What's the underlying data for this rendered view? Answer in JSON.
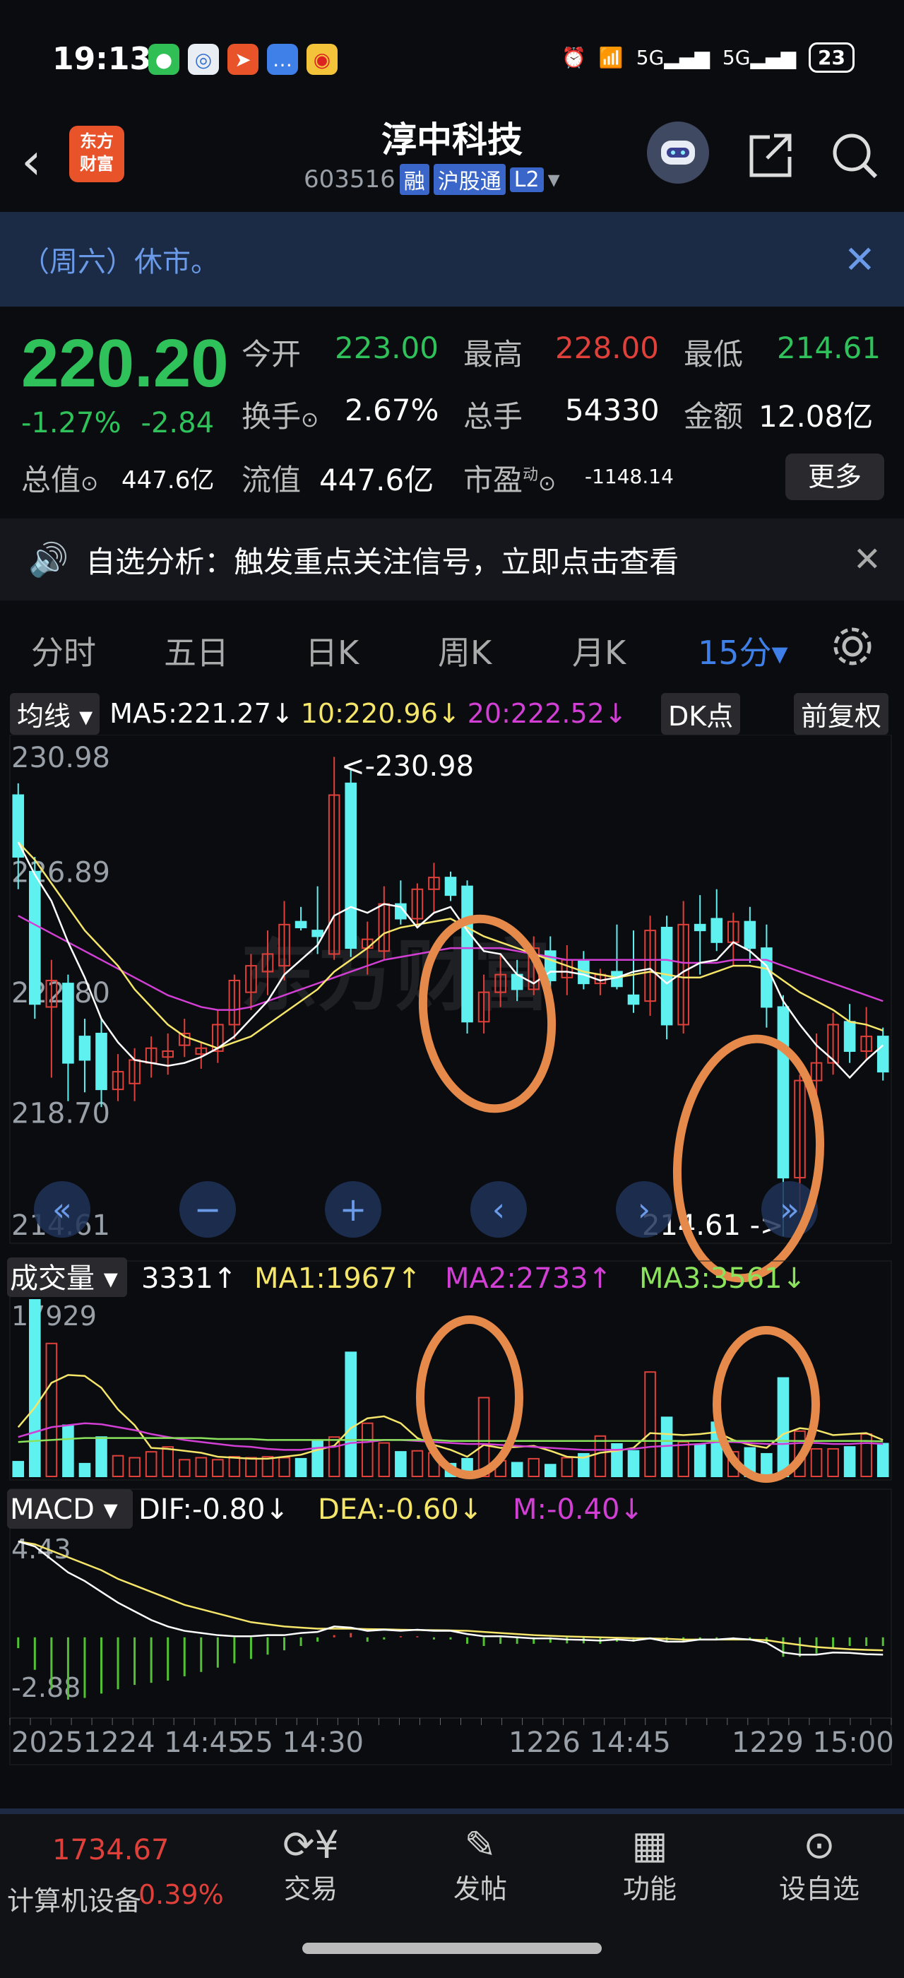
{
  "status": {
    "time": "19:13",
    "network": "5G",
    "battery": "23"
  },
  "header": {
    "title": "淳中科技",
    "code": "603516",
    "tags": [
      "融",
      "沪股通",
      "L2"
    ],
    "logo_line1": "东方",
    "logo_line2": "财富"
  },
  "notice": {
    "text": "（周六）休市。"
  },
  "quote": {
    "price": "220.20",
    "change_pct": "-1.27%",
    "change": "-2.84",
    "open_label": "今开",
    "open": "223.00",
    "high_label": "最高",
    "high": "228.00",
    "low_label": "最低",
    "low": "214.61",
    "turnover_label": "换手",
    "turnover": "2.67%",
    "volume_label": "总手",
    "volume": "54330",
    "amount_label": "金额",
    "amount": "12.08亿",
    "mktcap_label": "总值",
    "mktcap": "447.6亿",
    "float_label": "流值",
    "float": "447.6亿",
    "pe_label": "市盈",
    "pe_sup": "动",
    "pe": "-1148.14",
    "more": "更多"
  },
  "announcement": {
    "text": "自选分析：触发重点关注信号，立即点击查看"
  },
  "tabs": [
    "分时",
    "五日",
    "日K",
    "周K",
    "月K",
    "15分▾"
  ],
  "ma": {
    "selector": "均线",
    "ma5": "MA5:221.27↓",
    "ma10": "10:220.96↓",
    "ma20": "20:222.52↓",
    "dk": "DK点",
    "fq": "前复权"
  },
  "kline": {
    "y_labels": [
      "230.98",
      "226.89",
      "222.80",
      "218.70",
      "214.61"
    ],
    "max_label": "<-230.98",
    "min_label": "214.61 ->",
    "watermark": "东方财富"
  },
  "volume": {
    "selector": "成交量",
    "cur": "3331↑",
    "ma1": "MA1:1967↑",
    "ma2": "MA2:2733↑",
    "ma3": "MA3:3561↓",
    "ymax": "17929"
  },
  "macd": {
    "selector": "MACD",
    "dif": "DIF:-0.80↓",
    "dea": "DEA:-0.60↓",
    "m": "M:-0.40↓",
    "ymax": "4.43",
    "ymin": "-2.88"
  },
  "xaxis": {
    "l1": "20251224 14:45",
    "l2": "25 14:30",
    "l3": "1226 14:45",
    "l4": "1229 15:00"
  },
  "bottom": {
    "index_value": "1734.67",
    "index_name": "计算机设备",
    "index_pct": "0.39%",
    "nav": [
      "交易",
      "发帖",
      "功能",
      "设自选"
    ]
  },
  "colors": {
    "up": "#e0403a",
    "down": "#5ff0f0",
    "ma5": "#ffffff",
    "ma10": "#f5e66a",
    "ma20": "#d23fd4",
    "ma3": "#8be25d",
    "accent": "#3f7fe8"
  },
  "chart_data": {
    "type": "candlestick",
    "ylim": [
      214.61,
      230.98
    ],
    "candles": [
      {
        "o": 229.6,
        "h": 230.0,
        "l": 226.4,
        "c": 227.5
      },
      {
        "o": 227.0,
        "h": 227.5,
        "l": 222.0,
        "c": 222.5
      },
      {
        "o": 222.4,
        "h": 224.0,
        "l": 220.0,
        "c": 223.3
      },
      {
        "o": 223.2,
        "h": 223.5,
        "l": 219.2,
        "c": 220.5
      },
      {
        "o": 221.4,
        "h": 222.0,
        "l": 219.5,
        "c": 220.6
      },
      {
        "o": 221.5,
        "h": 222.0,
        "l": 219.0,
        "c": 219.6
      },
      {
        "o": 219.6,
        "h": 220.8,
        "l": 219.2,
        "c": 220.2
      },
      {
        "o": 219.8,
        "h": 221.0,
        "l": 219.2,
        "c": 220.6
      },
      {
        "o": 220.5,
        "h": 221.4,
        "l": 220.0,
        "c": 221.0
      },
      {
        "o": 220.7,
        "h": 221.5,
        "l": 220.1,
        "c": 220.9
      },
      {
        "o": 221.1,
        "h": 222.0,
        "l": 220.7,
        "c": 221.5
      },
      {
        "o": 220.8,
        "h": 221.2,
        "l": 220.3,
        "c": 221.0
      },
      {
        "o": 220.9,
        "h": 222.3,
        "l": 220.5,
        "c": 221.8
      },
      {
        "o": 221.8,
        "h": 223.5,
        "l": 221.3,
        "c": 223.3
      },
      {
        "o": 222.9,
        "h": 224.2,
        "l": 222.3,
        "c": 223.8
      },
      {
        "o": 223.6,
        "h": 225.0,
        "l": 222.8,
        "c": 224.2
      },
      {
        "o": 223.8,
        "h": 226.0,
        "l": 223.3,
        "c": 225.2
      },
      {
        "o": 225.3,
        "h": 225.8,
        "l": 225.0,
        "c": 225.1
      },
      {
        "o": 225.0,
        "h": 226.5,
        "l": 224.2,
        "c": 224.8
      },
      {
        "o": 224.2,
        "h": 230.9,
        "l": 224.0,
        "c": 229.6
      },
      {
        "o": 230.0,
        "h": 230.5,
        "l": 224.1,
        "c": 224.4
      },
      {
        "o": 224.4,
        "h": 225.3,
        "l": 223.5,
        "c": 224.7
      },
      {
        "o": 224.3,
        "h": 226.5,
        "l": 224.0,
        "c": 225.9
      },
      {
        "o": 225.9,
        "h": 226.7,
        "l": 225.2,
        "c": 225.4
      },
      {
        "o": 225.4,
        "h": 226.6,
        "l": 225.1,
        "c": 226.4
      },
      {
        "o": 226.4,
        "h": 227.3,
        "l": 225.6,
        "c": 226.8
      },
      {
        "o": 226.8,
        "h": 227.0,
        "l": 226.0,
        "c": 226.2
      },
      {
        "o": 226.5,
        "h": 226.7,
        "l": 221.5,
        "c": 221.9
      },
      {
        "o": 221.9,
        "h": 223.5,
        "l": 221.5,
        "c": 222.9
      },
      {
        "o": 222.9,
        "h": 224.2,
        "l": 222.4,
        "c": 223.5
      },
      {
        "o": 223.5,
        "h": 224.0,
        "l": 222.6,
        "c": 223.0
      },
      {
        "o": 223.0,
        "h": 224.8,
        "l": 222.8,
        "c": 224.4
      },
      {
        "o": 224.3,
        "h": 224.8,
        "l": 223.0,
        "c": 223.3
      },
      {
        "o": 223.4,
        "h": 224.5,
        "l": 222.8,
        "c": 224.0
      },
      {
        "o": 224.0,
        "h": 224.3,
        "l": 223.0,
        "c": 223.2
      },
      {
        "o": 223.2,
        "h": 223.7,
        "l": 222.8,
        "c": 223.5
      },
      {
        "o": 223.6,
        "h": 225.2,
        "l": 223.0,
        "c": 223.1
      },
      {
        "o": 222.8,
        "h": 225.0,
        "l": 222.2,
        "c": 222.5
      },
      {
        "o": 222.6,
        "h": 225.5,
        "l": 222.1,
        "c": 225.0
      },
      {
        "o": 225.1,
        "h": 225.5,
        "l": 221.3,
        "c": 221.8
      },
      {
        "o": 221.8,
        "h": 226.0,
        "l": 221.5,
        "c": 225.2
      },
      {
        "o": 225.2,
        "h": 226.2,
        "l": 223.5,
        "c": 225.0
      },
      {
        "o": 225.4,
        "h": 226.4,
        "l": 224.3,
        "c": 224.6
      },
      {
        "o": 224.6,
        "h": 225.6,
        "l": 223.8,
        "c": 225.3
      },
      {
        "o": 225.3,
        "h": 225.8,
        "l": 223.9,
        "c": 224.4
      },
      {
        "o": 224.4,
        "h": 225.2,
        "l": 221.7,
        "c": 222.4
      },
      {
        "o": 222.4,
        "h": 222.8,
        "l": 214.61,
        "c": 216.6
      },
      {
        "o": 216.6,
        "h": 220.1,
        "l": 215.4,
        "c": 219.9
      },
      {
        "o": 219.9,
        "h": 221.5,
        "l": 219.2,
        "c": 220.5
      },
      {
        "o": 220.5,
        "h": 222.2,
        "l": 220.1,
        "c": 221.8
      },
      {
        "o": 221.9,
        "h": 222.5,
        "l": 220.5,
        "c": 220.9
      },
      {
        "o": 220.9,
        "h": 222.4,
        "l": 220.6,
        "c": 221.4
      },
      {
        "o": 221.4,
        "h": 221.7,
        "l": 219.9,
        "c": 220.2
      }
    ],
    "ma5": [
      228.0,
      226.9,
      226.0,
      224.6,
      223.4,
      222.0,
      221.2,
      220.6,
      220.5,
      220.4,
      220.5,
      220.7,
      221.0,
      221.4,
      222.0,
      222.6,
      223.5,
      224.0,
      224.5,
      225.5,
      225.8,
      225.6,
      225.9,
      225.8,
      225.1,
      225.6,
      225.8,
      225.0,
      224.3,
      224.2,
      223.5,
      223.2,
      223.6,
      223.6,
      223.5,
      223.3,
      223.4,
      223.6,
      223.7,
      223.2,
      223.6,
      223.9,
      224.0,
      224.6,
      224.3,
      223.8,
      222.6,
      221.8,
      221.1,
      220.6,
      220.0,
      220.6,
      221.1
    ],
    "ma10": [
      228.0,
      227.4,
      226.6,
      225.8,
      225.0,
      224.4,
      223.8,
      223.0,
      222.4,
      221.8,
      221.4,
      221.2,
      221.0,
      221.2,
      221.4,
      221.8,
      222.2,
      222.6,
      223.0,
      223.6,
      224.0,
      224.4,
      224.9,
      225.1,
      225.2,
      225.3,
      225.4,
      225.1,
      224.8,
      224.6,
      224.4,
      224.2,
      224.0,
      223.8,
      223.6,
      223.5,
      223.4,
      223.5,
      223.6,
      223.5,
      223.4,
      223.4,
      223.6,
      223.8,
      223.8,
      223.7,
      223.3,
      222.9,
      222.6,
      222.3,
      221.9,
      221.8,
      221.6
    ],
    "ma20": [
      225.5,
      225.2,
      224.9,
      224.6,
      224.3,
      224.0,
      223.7,
      223.4,
      223.1,
      222.8,
      222.6,
      222.4,
      222.3,
      222.3,
      222.4,
      222.6,
      222.8,
      223.0,
      223.2,
      223.4,
      223.6,
      223.8,
      224.0,
      224.1,
      224.2,
      224.3,
      224.4,
      224.4,
      224.4,
      224.4,
      224.3,
      224.2,
      224.1,
      224.0,
      224.0,
      224.0,
      224.0,
      224.0,
      224.0,
      224.0,
      223.9,
      223.9,
      223.9,
      224.0,
      224.0,
      224.0,
      223.8,
      223.6,
      223.4,
      223.2,
      223.0,
      222.8,
      222.6
    ],
    "volume": [
      1500,
      17929,
      13500,
      5200,
      1300,
      4000,
      2100,
      1900,
      2500,
      3000,
      1700,
      1900,
      1700,
      2000,
      1900,
      2000,
      1900,
      1800,
      3600,
      4000,
      12600,
      5400,
      3400,
      2500,
      2600,
      2400,
      1300,
      1800,
      8000,
      1600,
      1400,
      1800,
      1200,
      1900,
      2300,
      4100,
      3300,
      2600,
      10600,
      6000,
      3500,
      3200,
      5500,
      2500,
      2900,
      2300,
      10000,
      4600,
      2800,
      2800,
      3000,
      4300,
      3331
    ],
    "vol_ma1": [
      5000,
      7000,
      9500,
      10300,
      10200,
      9000,
      6800,
      5200,
      2900,
      2800,
      2600,
      2400,
      2000,
      1900,
      1800,
      1800,
      2000,
      2200,
      2700,
      3100,
      4900,
      5900,
      6100,
      5400,
      3900,
      3200,
      2700,
      2000,
      3200,
      2900,
      3000,
      3100,
      2600,
      2000,
      1900,
      2400,
      2600,
      2900,
      4400,
      4300,
      4200,
      4300,
      4500,
      3700,
      3200,
      2900,
      4300,
      4900,
      4700,
      4200,
      4300,
      4400,
      3700
    ],
    "vol_ma2": [
      4000,
      4500,
      5000,
      5200,
      5400,
      5300,
      5000,
      4700,
      4300,
      4000,
      3700,
      3500,
      3300,
      3100,
      3000,
      2800,
      2700,
      2700,
      2900,
      3000,
      3400,
      3500,
      3700,
      3700,
      3600,
      3500,
      3400,
      3300,
      3300,
      3200,
      3100,
      3000,
      2900,
      2800,
      2700,
      2700,
      2700,
      2800,
      3000,
      3100,
      3200,
      3300,
      3500,
      3500,
      3400,
      3300,
      3300,
      3400,
      3400,
      3300,
      3300,
      3400,
      3300
    ],
    "vol_ma3": [
      3500,
      3600,
      3700,
      3800,
      3900,
      3900,
      3900,
      3900,
      3900,
      3900,
      3900,
      3900,
      3800,
      3800,
      3800,
      3700,
      3700,
      3700,
      3700,
      3700,
      3700,
      3700,
      3700,
      3700,
      3700,
      3700,
      3600,
      3600,
      3600,
      3600,
      3600,
      3600,
      3600,
      3600,
      3600,
      3600,
      3600,
      3600,
      3600,
      3600,
      3600,
      3600,
      3600,
      3600,
      3600,
      3600,
      3600,
      3600,
      3600,
      3600,
      3600,
      3600,
      3561
    ],
    "dif": [
      4.43,
      4.2,
      3.6,
      3.0,
      2.6,
      2.1,
      1.6,
      1.2,
      0.8,
      0.5,
      0.3,
      0.2,
      0.1,
      0.05,
      0.05,
      0.1,
      0.1,
      0.2,
      0.25,
      0.5,
      0.45,
      0.3,
      0.35,
      0.3,
      0.35,
      0.3,
      0.3,
      0.15,
      0.05,
      0.05,
      0.0,
      -0.05,
      -0.05,
      -0.1,
      -0.12,
      -0.15,
      -0.1,
      -0.15,
      -0.05,
      -0.2,
      -0.2,
      -0.1,
      -0.1,
      -0.05,
      -0.1,
      -0.25,
      -0.7,
      -0.8,
      -0.8,
      -0.7,
      -0.72,
      -0.78,
      -0.8
    ],
    "dea": [
      4.43,
      4.3,
      4.0,
      3.7,
      3.4,
      3.1,
      2.7,
      2.4,
      2.1,
      1.8,
      1.5,
      1.3,
      1.1,
      0.9,
      0.7,
      0.6,
      0.5,
      0.45,
      0.4,
      0.4,
      0.4,
      0.38,
      0.37,
      0.35,
      0.34,
      0.33,
      0.32,
      0.3,
      0.25,
      0.2,
      0.15,
      0.1,
      0.07,
      0.04,
      0.02,
      0.0,
      -0.02,
      -0.04,
      -0.05,
      -0.07,
      -0.1,
      -0.1,
      -0.1,
      -0.1,
      -0.1,
      -0.13,
      -0.25,
      -0.35,
      -0.45,
      -0.5,
      -0.55,
      -0.58,
      -0.6
    ],
    "m": [
      -0.5,
      -1.5,
      -2.4,
      -2.88,
      -2.8,
      -2.6,
      -2.4,
      -2.2,
      -2.1,
      -2.0,
      -1.8,
      -1.6,
      -1.4,
      -1.2,
      -1.0,
      -0.8,
      -0.6,
      -0.4,
      -0.2,
      0.1,
      0.2,
      -0.2,
      -0.1,
      0.05,
      0.05,
      -0.1,
      -0.1,
      -0.3,
      -0.4,
      -0.3,
      -0.3,
      -0.3,
      -0.25,
      -0.28,
      -0.28,
      -0.3,
      -0.2,
      -0.2,
      -0.1,
      -0.2,
      -0.2,
      -0.1,
      -0.1,
      -0.1,
      -0.1,
      -0.25,
      -0.9,
      -0.9,
      -0.75,
      -0.5,
      -0.4,
      -0.4,
      -0.4
    ]
  }
}
